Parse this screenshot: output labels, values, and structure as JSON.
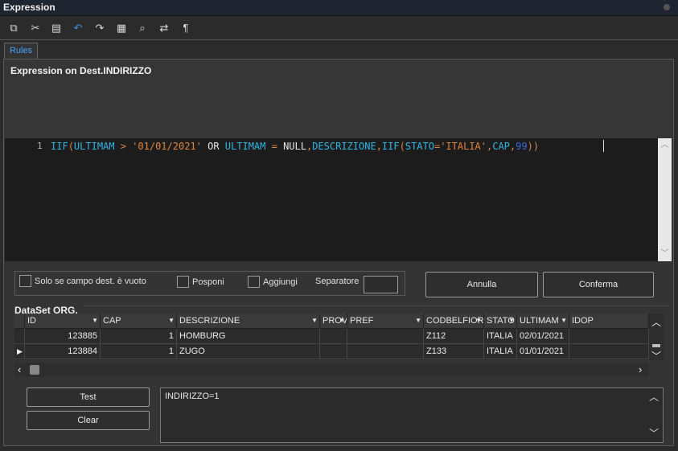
{
  "window": {
    "title": "Expression"
  },
  "toolbar": {
    "icons": [
      "copy-icon",
      "cut-icon",
      "paste-icon",
      "undo-icon",
      "redo-icon",
      "select-all-icon",
      "find-icon",
      "replace-icon",
      "format-icon"
    ]
  },
  "tabs": [
    {
      "label": "Rules",
      "active": true
    }
  ],
  "expression": {
    "heading": "Expression on Dest.INDIRIZZO",
    "line_number": "1",
    "tokens": [
      {
        "t": "IIF",
        "c": "fn"
      },
      {
        "t": "(",
        "c": "op"
      },
      {
        "t": "ULTIMAM",
        "c": "fn"
      },
      {
        "t": " > ",
        "c": "op"
      },
      {
        "t": "'01/01/2021'",
        "c": "str"
      },
      {
        "t": " OR ",
        "c": "kw"
      },
      {
        "t": "ULTIMAM",
        "c": "fn"
      },
      {
        "t": " = ",
        "c": "op"
      },
      {
        "t": "NULL",
        "c": "kw"
      },
      {
        "t": ",",
        "c": "op"
      },
      {
        "t": "DESCRIZIONE",
        "c": "fn"
      },
      {
        "t": ",",
        "c": "op"
      },
      {
        "t": "IIF",
        "c": "fn"
      },
      {
        "t": "(",
        "c": "op"
      },
      {
        "t": "STATO",
        "c": "fn"
      },
      {
        "t": "=",
        "c": "op"
      },
      {
        "t": "'ITALIA'",
        "c": "str"
      },
      {
        "t": ",",
        "c": "op"
      },
      {
        "t": "CAP",
        "c": "fn"
      },
      {
        "t": ",",
        "c": "op"
      },
      {
        "t": "99",
        "c": "num"
      },
      {
        "t": "))",
        "c": "op"
      }
    ]
  },
  "options": {
    "only_if_empty_label": "Solo se campo dest. è vuoto",
    "postpone_label": "Posponi",
    "append_label": "Aggiungi",
    "separator_label": "Separatore",
    "separator_value": ""
  },
  "buttons": {
    "cancel": "Annulla",
    "confirm": "Conferma",
    "test": "Test",
    "clear": "Clear"
  },
  "dataset": {
    "title": "DataSet ORG.",
    "columns": [
      "ID",
      "CAP",
      "DESCRIZIONE",
      "PROV",
      "PREF",
      "CODBELFIORE",
      "STATO",
      "ULTIMAM",
      "IDOP"
    ],
    "rows": [
      [
        "123885",
        "1",
        "HOMBURG",
        "",
        "",
        "Z112",
        "ITALIA",
        "02/01/2021",
        ""
      ],
      [
        "123884",
        "1",
        "ZUGO",
        "",
        "",
        "Z133",
        "ITALIA",
        "01/01/2021",
        ""
      ]
    ],
    "current_row": 1
  },
  "result": {
    "text": "INDIRIZZO=1"
  }
}
